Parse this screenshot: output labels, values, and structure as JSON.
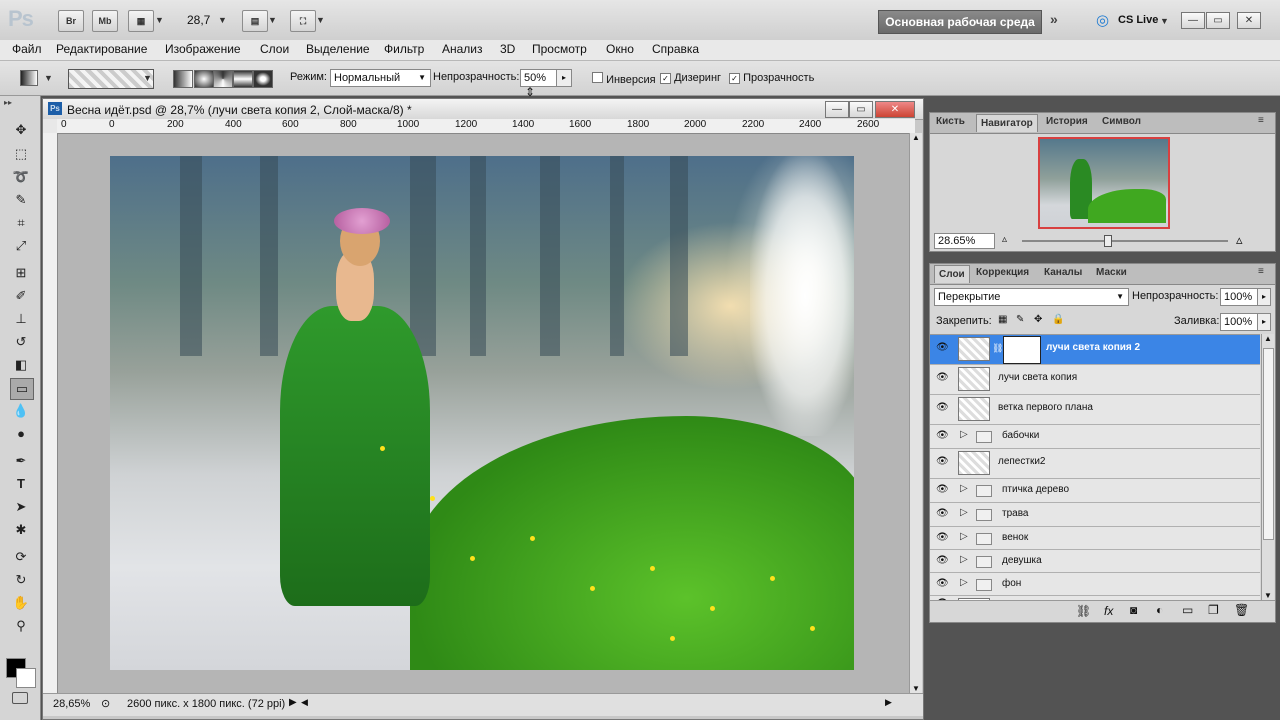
{
  "appbar": {
    "logo": "Ps",
    "icons": [
      "Br",
      "Mb"
    ],
    "zoom": "28,7",
    "workspace": "Основная рабочая среда",
    "cslive": "CS Live"
  },
  "menu": [
    "Файл",
    "Редактирование",
    "Изображение",
    "Слои",
    "Выделение",
    "Фильтр",
    "Анализ",
    "3D",
    "Просмотр",
    "Окно",
    "Справка"
  ],
  "options": {
    "mode_label": "Режим:",
    "mode_value": "Нормальный",
    "opacity_label": "Непрозрачность:",
    "opacity_value": "50%",
    "inverse": "Инверсия",
    "dither": "Дизеринг",
    "transparency": "Прозрачность"
  },
  "document": {
    "title": "Весна идёт.psd @ 28,7% (лучи света копия 2, Слой-маска/8) *",
    "ruler_ticks": [
      "0",
      "200",
      "400",
      "600",
      "800",
      "1000",
      "1200",
      "1400",
      "1600",
      "1800",
      "2000",
      "2200",
      "2400",
      "2600"
    ],
    "zoom": "28,65%",
    "info": "2600 пикс. x 1800 пикс. (72 ppi)"
  },
  "navigator": {
    "tabs": [
      "Кисть",
      "Навигатор",
      "История",
      "Символ"
    ],
    "active_tab": "Навигатор",
    "zoom": "28.65%"
  },
  "layers_panel": {
    "tabs": [
      "Слои",
      "Коррекция",
      "Каналы",
      "Маски"
    ],
    "active_tab": "Слои",
    "blend_mode": "Перекрытие",
    "opacity_label": "Непрозрачность:",
    "opacity_value": "100%",
    "lock_label": "Закрепить:",
    "fill_label": "Заливка:",
    "fill_value": "100%",
    "layers": [
      {
        "name": "лучи света копия 2",
        "type": "layer",
        "selected": true,
        "mask": true
      },
      {
        "name": "лучи света копия",
        "type": "layer"
      },
      {
        "name": "ветка первого плана",
        "type": "layer"
      },
      {
        "name": "бабочки",
        "type": "group"
      },
      {
        "name": "лепестки2",
        "type": "layer"
      },
      {
        "name": "птичка дерево",
        "type": "group"
      },
      {
        "name": "трава",
        "type": "group"
      },
      {
        "name": "венок",
        "type": "group"
      },
      {
        "name": "девушка",
        "type": "group"
      },
      {
        "name": "фон",
        "type": "group"
      }
    ]
  },
  "colors": {
    "accent": "#3b85e6",
    "workspace_btn": "#7a7a7a",
    "bg": "#535353"
  }
}
